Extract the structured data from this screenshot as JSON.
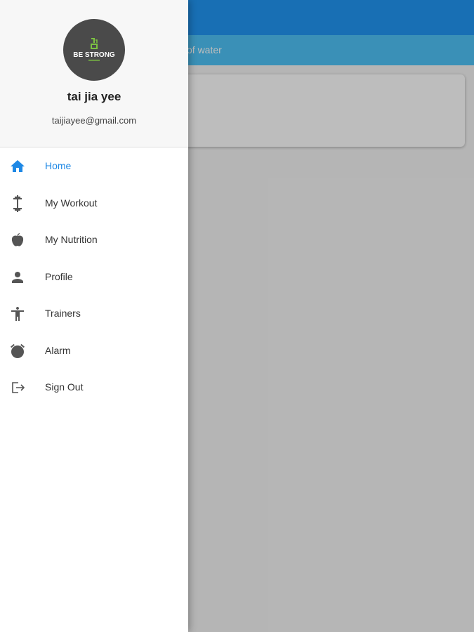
{
  "background": {
    "subbar_text": "of water"
  },
  "drawer": {
    "logo_text": "BE STRONG",
    "user_name": "tai jia yee",
    "user_email": "taijiayee@gmail.com",
    "items": [
      {
        "label": "Home",
        "icon": "home-icon",
        "active": true
      },
      {
        "label": "My Workout",
        "icon": "dumbbell-icon",
        "active": false
      },
      {
        "label": "My Nutrition",
        "icon": "apple-icon",
        "active": false
      },
      {
        "label": "Profile",
        "icon": "person-icon",
        "active": false
      },
      {
        "label": "Trainers",
        "icon": "accessibility-icon",
        "active": false
      },
      {
        "label": "Alarm",
        "icon": "alarm-clock-icon",
        "active": false
      },
      {
        "label": "Sign Out",
        "icon": "logout-icon",
        "active": false
      }
    ]
  },
  "colors": {
    "accent": "#1e88e5",
    "appbar": "#2196f3",
    "subbar": "#4fc3f7",
    "logo_green": "#7cc242"
  }
}
